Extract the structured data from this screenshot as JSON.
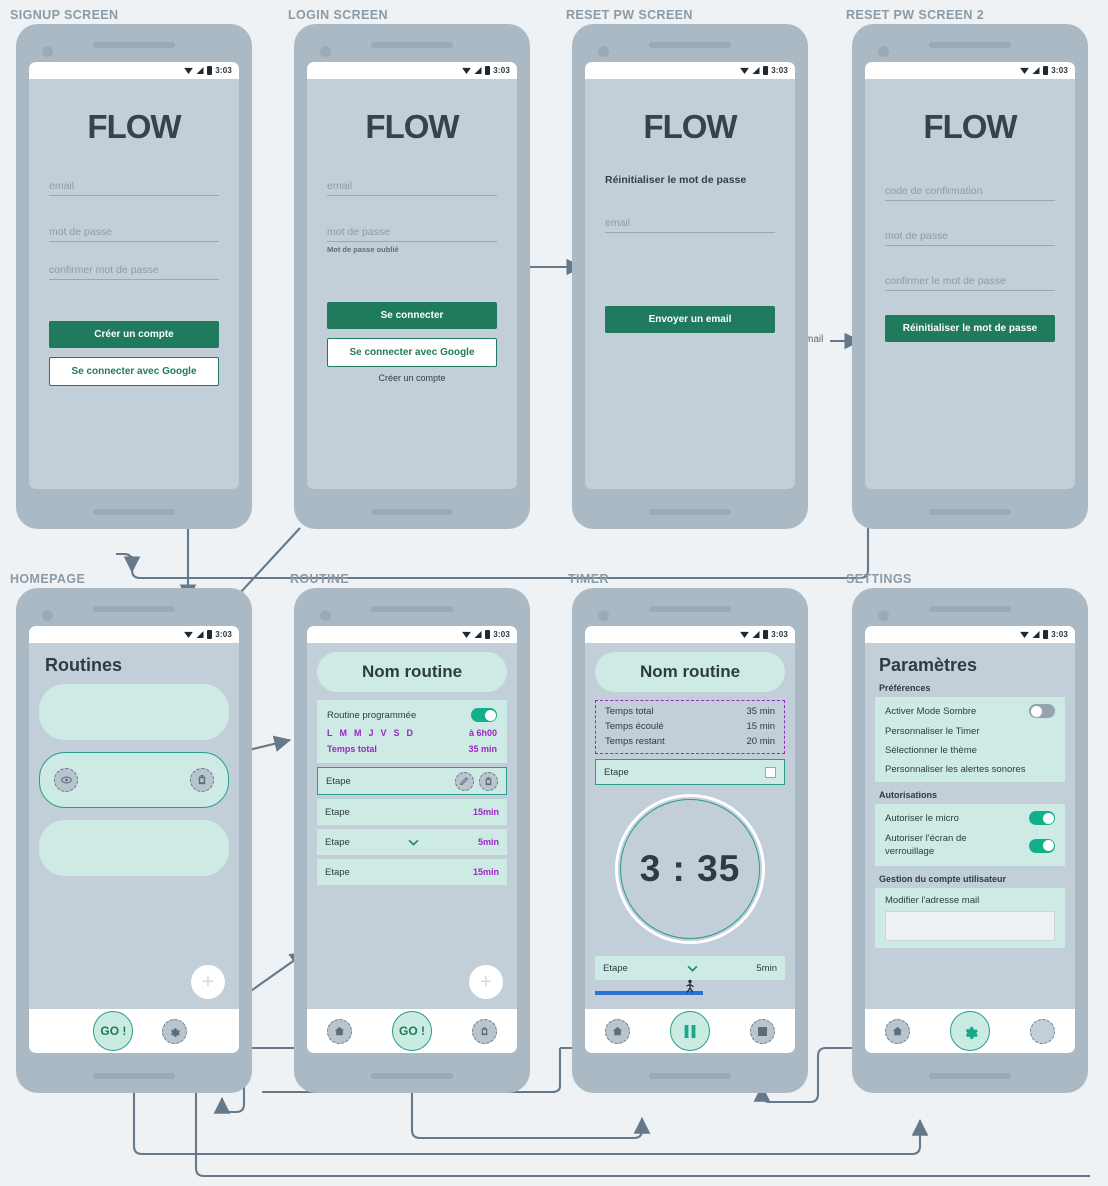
{
  "meta": {
    "status_time": "3:03",
    "brand": "FLOW"
  },
  "flow_labels": {
    "mail": "mail"
  },
  "screens": [
    {
      "id": "signup",
      "label": "SIGNUP SCREEN",
      "brand": "FLOW",
      "fields": [
        {
          "name": "email",
          "placeholder": "email"
        },
        {
          "name": "password",
          "placeholder": "mot de passe"
        },
        {
          "name": "confirm",
          "placeholder": "confirmer mot de passe"
        }
      ],
      "primary_button": "Créer un compte",
      "outline_button": "Se connecter avec Google"
    },
    {
      "id": "login",
      "label": "LOGIN SCREEN",
      "brand": "FLOW",
      "fields": [
        {
          "name": "email",
          "placeholder": "email"
        },
        {
          "name": "password",
          "placeholder": "mot de passe"
        }
      ],
      "forgot_link": "Mot de passe oublié",
      "primary_button": "Se connecter",
      "outline_button": "Se connecter avec Google",
      "text_link": "Créer un compte"
    },
    {
      "id": "reset1",
      "label": "RESET PW SCREEN",
      "brand": "FLOW",
      "subtitle": "Réinitialiser le mot de passe",
      "fields": [
        {
          "name": "email",
          "placeholder": "email"
        }
      ],
      "primary_button": "Envoyer un email"
    },
    {
      "id": "reset2",
      "label": "RESET PW SCREEN 2",
      "brand": "FLOW",
      "fields": [
        {
          "name": "code",
          "placeholder": "code de confirmation"
        },
        {
          "name": "password",
          "placeholder": "mot de passe"
        },
        {
          "name": "confirm",
          "placeholder": "confirmer le mot de passe"
        }
      ],
      "primary_button": "Réinitialiser le mot de passe"
    }
  ],
  "homepage": {
    "label": "HOMEPAGE",
    "title": "Routines",
    "cards": [
      {
        "selected": false
      },
      {
        "selected": true
      },
      {
        "selected": false
      }
    ],
    "fab": "+",
    "nav": {
      "go": "GO !",
      "settings_icon": "gear-icon"
    }
  },
  "routine": {
    "label": "ROUTINE",
    "name": "Nom routine",
    "schedule": {
      "toggle_label": "Routine programmée",
      "toggle_on": true,
      "days": [
        "L",
        "M",
        "M",
        "J",
        "V",
        "S",
        "D"
      ],
      "time": "à 6h00",
      "total_label": "Temps total",
      "total_value": "35 min"
    },
    "steps": [
      {
        "label": "Etape",
        "duration": "",
        "selected": true,
        "has_chevron": false
      },
      {
        "label": "Etape",
        "duration": "15min",
        "selected": false,
        "has_chevron": false
      },
      {
        "label": "Etape",
        "duration": "5min",
        "selected": false,
        "has_chevron": true
      },
      {
        "label": "Etape",
        "duration": "15min",
        "selected": false,
        "has_chevron": false
      }
    ],
    "fab": "+",
    "nav": {
      "home_icon": "home-icon",
      "go": "GO !",
      "delete_icon": "trash-icon"
    }
  },
  "timer": {
    "label": "TIMER",
    "name": "Nom routine",
    "times": [
      {
        "label": "Temps total",
        "value": "35 min"
      },
      {
        "label": "Temps écoulé",
        "value": "15 min"
      },
      {
        "label": "Temps restant",
        "value": "20 min"
      }
    ],
    "current_step": "Etape",
    "countdown": "3 : 35",
    "selector": {
      "label": "Etape",
      "duration": "5min"
    },
    "progress_percent": 57,
    "nav": {
      "home_icon": "home-icon",
      "pause_icon": "pause-icon",
      "stop_icon": "stop-icon"
    }
  },
  "settings": {
    "label": "SETTINGS",
    "title": "Paramètres",
    "sections": [
      {
        "heading": "Préférences",
        "rows": [
          {
            "label": "Activer Mode Sombre",
            "toggle": false
          },
          {
            "label": "Personnaliser le Timer",
            "toggle": null
          },
          {
            "label": "Sélectionner le thème",
            "toggle": null
          },
          {
            "label": "Personnaliser les alertes sonores",
            "toggle": null
          }
        ]
      },
      {
        "heading": "Autorisations",
        "rows": [
          {
            "label": "Autoriser le micro",
            "toggle": true
          },
          {
            "label": "Autoriser l'écran de verrouillage",
            "toggle": true
          }
        ]
      },
      {
        "heading": "Gestion du compte utilisateur",
        "rows": [
          {
            "label": "Modifier l'adresse mail",
            "toggle": null
          }
        ]
      }
    ],
    "nav": {
      "home_icon": "home-icon",
      "gear_icon": "gear-icon",
      "third_icon": "blank-icon"
    }
  },
  "colors": {
    "accent_green": "#1f7a5e",
    "teal": "#2a9d8a",
    "mint": "#cdeae4",
    "purple": "#9b27c4",
    "bezel": "#aab9c4",
    "screen_bg": "#c3cfd8",
    "page_bg": "#eef2f4",
    "wire": "#66798a",
    "progress_blue": "#2a72d4"
  }
}
